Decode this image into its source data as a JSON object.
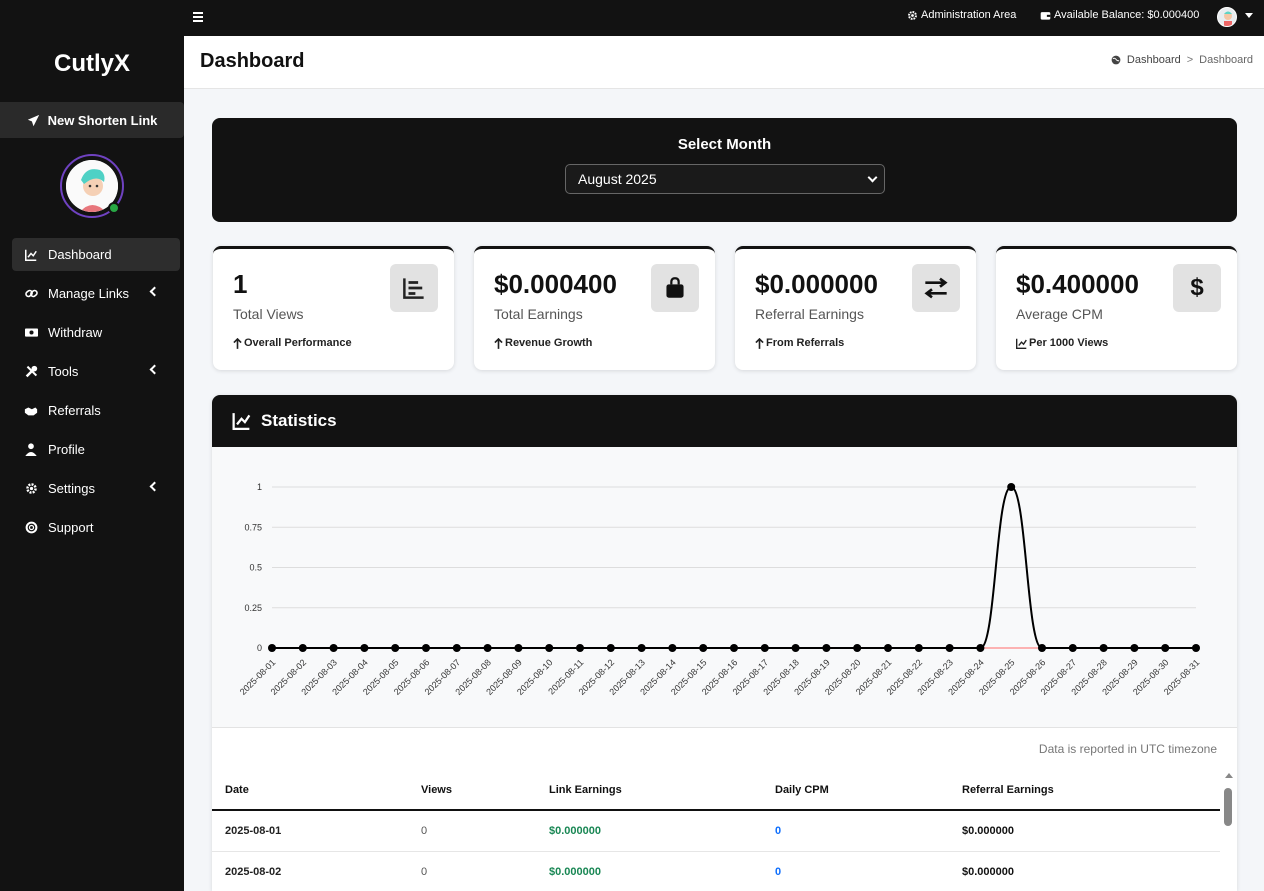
{
  "topbar": {
    "admin_label": "Administration Area",
    "balance_label": "Available Balance: $0.000400"
  },
  "sidebar": {
    "brand": "CutlyX",
    "new_link_label": "New Shorten Link",
    "items": [
      {
        "label": "Dashboard",
        "icon": "chart-line-icon"
      },
      {
        "label": "Manage Links",
        "icon": "link-icon"
      },
      {
        "label": "Withdraw",
        "icon": "money-bill-icon"
      },
      {
        "label": "Tools",
        "icon": "tools-icon"
      },
      {
        "label": "Referrals",
        "icon": "handshake-icon"
      },
      {
        "label": "Profile",
        "icon": "user-icon"
      },
      {
        "label": "Settings",
        "icon": "gear-icon"
      },
      {
        "label": "Support",
        "icon": "life-ring-icon"
      }
    ]
  },
  "header": {
    "title": "Dashboard",
    "breadcrumb": [
      "Dashboard",
      "Dashboard"
    ],
    "breadcrumb_sep": ">"
  },
  "month": {
    "label": "Select Month",
    "selected": "August 2025"
  },
  "cards": [
    {
      "value": "1",
      "name": "Total Views",
      "foot": "Overall Performance",
      "icon": "chart-bar-icon"
    },
    {
      "value": "$0.000400",
      "name": "Total Earnings",
      "foot": "Revenue Growth",
      "icon": "shopping-bag-icon"
    },
    {
      "value": "$0.000000",
      "name": "Referral Earnings",
      "foot": "From Referrals",
      "icon": "exchange-icon"
    },
    {
      "value": "$0.400000",
      "name": "Average CPM",
      "foot": "Per 1000 Views",
      "icon": "dollar-icon"
    }
  ],
  "stats": {
    "title": "Statistics",
    "utc_note": "Data is reported in UTC timezone",
    "columns": [
      "Date",
      "Views",
      "Link Earnings",
      "Daily CPM",
      "Referral Earnings"
    ],
    "rows": [
      [
        "2025-08-01",
        "0",
        "$0.000000",
        "0",
        "$0.000000"
      ],
      [
        "2025-08-02",
        "0",
        "$0.000000",
        "0",
        "$0.000000"
      ]
    ]
  },
  "chart_data": {
    "type": "line",
    "x": [
      "2025-08-01",
      "2025-08-02",
      "2025-08-03",
      "2025-08-04",
      "2025-08-05",
      "2025-08-06",
      "2025-08-07",
      "2025-08-08",
      "2025-08-09",
      "2025-08-10",
      "2025-08-11",
      "2025-08-12",
      "2025-08-13",
      "2025-08-14",
      "2025-08-15",
      "2025-08-16",
      "2025-08-17",
      "2025-08-18",
      "2025-08-19",
      "2025-08-20",
      "2025-08-21",
      "2025-08-22",
      "2025-08-23",
      "2025-08-24",
      "2025-08-25",
      "2025-08-26",
      "2025-08-27",
      "2025-08-28",
      "2025-08-29",
      "2025-08-30",
      "2025-08-31"
    ],
    "series": [
      {
        "values": [
          0,
          0,
          0,
          0,
          0,
          0,
          0,
          0,
          0,
          0,
          0,
          0,
          0,
          0,
          0,
          0,
          0,
          0,
          0,
          0,
          0,
          0,
          0,
          0,
          1,
          0,
          0,
          0,
          0,
          0,
          0
        ],
        "color": "#000000"
      },
      {
        "values": [
          0,
          0,
          0,
          0,
          0,
          0,
          0,
          0,
          0,
          0,
          0,
          0,
          0,
          0,
          0,
          0,
          0,
          0,
          0,
          0,
          0,
          0,
          0,
          0,
          0,
          0,
          0,
          0,
          0,
          0,
          0
        ],
        "color": "#ff6b6b"
      }
    ],
    "yticks": [
      "0",
      "0.25",
      "0.5",
      "0.75",
      "1"
    ],
    "ylim": [
      0,
      1
    ],
    "grid": true
  }
}
